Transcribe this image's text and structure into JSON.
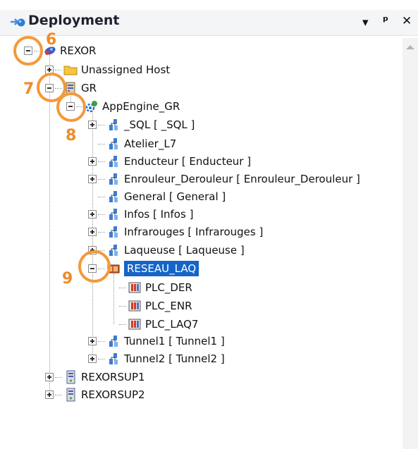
{
  "panel": {
    "title": "Deployment",
    "controls": {
      "dropdown": "▾",
      "pin": "ᵖ",
      "close": "✕"
    }
  },
  "tree": [
    {
      "label": "REXOR",
      "toggle": "minus",
      "icon": "galaxy-icon"
    },
    {
      "label": "Unassigned Host",
      "toggle": "plus",
      "icon": "folder-icon"
    },
    {
      "label": "GR",
      "toggle": "minus",
      "icon": "galaxy-repository-icon"
    },
    {
      "label": "AppEngine_GR",
      "toggle": "minus",
      "icon": "app-engine-icon"
    },
    {
      "label": "_SQL [ _SQL ]",
      "toggle": "plus",
      "icon": "area-icon"
    },
    {
      "label": "Atelier_L7",
      "toggle": "none",
      "icon": "area-icon"
    },
    {
      "label": "Enducteur [ Enducteur ]",
      "toggle": "plus",
      "icon": "area-icon"
    },
    {
      "label": "Enrouleur_Derouleur [ Enrouleur_Derouleur ]",
      "toggle": "plus",
      "icon": "area-icon"
    },
    {
      "label": "General [ General ]",
      "toggle": "none",
      "icon": "area-icon"
    },
    {
      "label": "Infos [ Infos ]",
      "toggle": "plus",
      "icon": "area-icon"
    },
    {
      "label": "Infrarouges [ Infrarouges ]",
      "toggle": "plus",
      "icon": "area-icon"
    },
    {
      "label": "Laqueuse [ Laqueuse ]",
      "toggle": "plus",
      "icon": "area-icon"
    },
    {
      "label": "RESEAU_LAQ",
      "toggle": "minus",
      "icon": "network-icon",
      "selected": true
    },
    {
      "label": "PLC_DER",
      "toggle": "none",
      "icon": "plc-icon"
    },
    {
      "label": "PLC_ENR",
      "toggle": "none",
      "icon": "plc-icon"
    },
    {
      "label": "PLC_LAQ7",
      "toggle": "none",
      "icon": "plc-icon"
    },
    {
      "label": "Tunnel1 [ Tunnel1 ]",
      "toggle": "plus",
      "icon": "area-icon"
    },
    {
      "label": "Tunnel2 [ Tunnel2 ]",
      "toggle": "plus",
      "icon": "area-icon"
    },
    {
      "label": "REXORSUP1",
      "toggle": "plus",
      "icon": "platform-icon"
    },
    {
      "label": "REXORSUP2",
      "toggle": "plus",
      "icon": "platform-icon"
    }
  ],
  "callouts": [
    "6",
    "7",
    "8",
    "9"
  ],
  "colors": {
    "accent": "#f39a3a",
    "selection": "#1565c8"
  }
}
